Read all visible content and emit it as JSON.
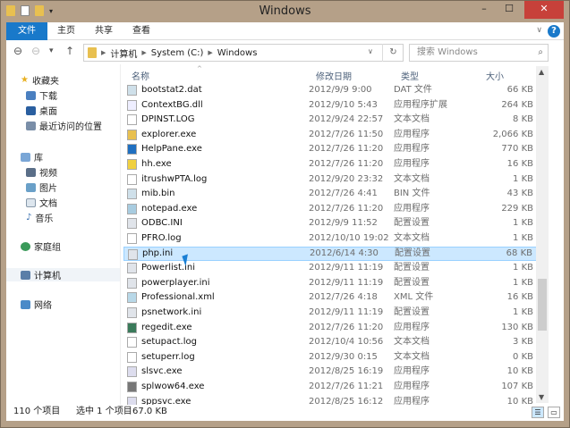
{
  "window": {
    "title": "Windows",
    "minimize": "–",
    "maximize": "☐",
    "close": "✕"
  },
  "ribbon": {
    "tabs": [
      "文件",
      "主页",
      "共享",
      "查看"
    ],
    "help": "?",
    "expand": "∨"
  },
  "nav": {
    "back": "⊖",
    "forward": "⊖",
    "recent": "▾",
    "up": "↑",
    "path": [
      "计算机",
      "System (C:)",
      "Windows"
    ],
    "refresh": "↻",
    "dropdown": "∨",
    "search_placeholder": "搜索 Windows",
    "search_icon": "⌕"
  },
  "sidebar": {
    "favorites": "收藏夹",
    "fav_items": [
      "下载",
      "桌面",
      "最近访问的位置"
    ],
    "libraries": "库",
    "lib_items": [
      "视频",
      "图片",
      "文档",
      "音乐"
    ],
    "homegroup": "家庭组",
    "computer": "计算机",
    "network": "网络"
  },
  "columns": {
    "name": "名称",
    "date": "修改日期",
    "type": "类型",
    "size": "大小"
  },
  "files": [
    {
      "name": "bootstat2.dat",
      "date": "2012/9/9 9:00",
      "type": "DAT 文件",
      "size": "66 KB",
      "icon": "file-icon"
    },
    {
      "name": "ContextBG.dll",
      "date": "2012/9/10 5:43",
      "type": "应用程序扩展",
      "size": "264 KB",
      "icon": "dll-icon"
    },
    {
      "name": "DPINST.LOG",
      "date": "2012/9/24 22:57",
      "type": "文本文档",
      "size": "8 KB",
      "icon": "text-icon"
    },
    {
      "name": "explorer.exe",
      "date": "2012/7/26 11:50",
      "type": "应用程序",
      "size": "2,066 KB",
      "icon": "explorer-icon"
    },
    {
      "name": "HelpPane.exe",
      "date": "2012/7/26 11:20",
      "type": "应用程序",
      "size": "770 KB",
      "icon": "help-icon"
    },
    {
      "name": "hh.exe",
      "date": "2012/7/26 11:20",
      "type": "应用程序",
      "size": "16 KB",
      "icon": "hh-icon"
    },
    {
      "name": "itrushwPTA.log",
      "date": "2012/9/20 23:32",
      "type": "文本文档",
      "size": "1 KB",
      "icon": "text-icon"
    },
    {
      "name": "mib.bin",
      "date": "2012/7/26 4:41",
      "type": "BIN 文件",
      "size": "43 KB",
      "icon": "file-icon"
    },
    {
      "name": "notepad.exe",
      "date": "2012/7/26 11:20",
      "type": "应用程序",
      "size": "229 KB",
      "icon": "notepad-icon"
    },
    {
      "name": "ODBC.INI",
      "date": "2012/9/9 11:52",
      "type": "配置设置",
      "size": "1 KB",
      "icon": "ini-icon"
    },
    {
      "name": "PFRO.log",
      "date": "2012/10/10 19:02",
      "type": "文本文档",
      "size": "1 KB",
      "icon": "text-icon"
    },
    {
      "name": "php.ini",
      "date": "2012/6/14 4:30",
      "type": "配置设置",
      "size": "68 KB",
      "icon": "ini-icon",
      "selected": true
    },
    {
      "name": "Powerlist.ini",
      "date": "2012/9/11 11:19",
      "type": "配置设置",
      "size": "1 KB",
      "icon": "ini-icon"
    },
    {
      "name": "powerplayer.ini",
      "date": "2012/9/11 11:19",
      "type": "配置设置",
      "size": "1 KB",
      "icon": "ini-icon"
    },
    {
      "name": "Professional.xml",
      "date": "2012/7/26 4:18",
      "type": "XML 文件",
      "size": "16 KB",
      "icon": "xml-icon"
    },
    {
      "name": "psnetwork.ini",
      "date": "2012/9/11 11:19",
      "type": "配置设置",
      "size": "1 KB",
      "icon": "ini-icon"
    },
    {
      "name": "regedit.exe",
      "date": "2012/7/26 11:20",
      "type": "应用程序",
      "size": "130 KB",
      "icon": "regedit-icon"
    },
    {
      "name": "setupact.log",
      "date": "2012/10/4 10:56",
      "type": "文本文档",
      "size": "3 KB",
      "icon": "text-icon"
    },
    {
      "name": "setuperr.log",
      "date": "2012/9/30 0:15",
      "type": "文本文档",
      "size": "0 KB",
      "icon": "text-icon"
    },
    {
      "name": "slsvc.exe",
      "date": "2012/8/25 16:19",
      "type": "应用程序",
      "size": "10 KB",
      "icon": "exe-icon"
    },
    {
      "name": "splwow64.exe",
      "date": "2012/7/26 11:21",
      "type": "应用程序",
      "size": "107 KB",
      "icon": "printer-icon"
    },
    {
      "name": "sppsvc.exe",
      "date": "2012/8/25 16:12",
      "type": "应用程序",
      "size": "10 KB",
      "icon": "exe-icon"
    }
  ],
  "status": {
    "count": "110 个项目",
    "selected": "选中 1 个项目",
    "size": "67.0 KB"
  },
  "colors": {
    "accent": "#1979ca",
    "selection": "#cce8ff",
    "close": "#c7413a",
    "frame": "#b5a088"
  }
}
